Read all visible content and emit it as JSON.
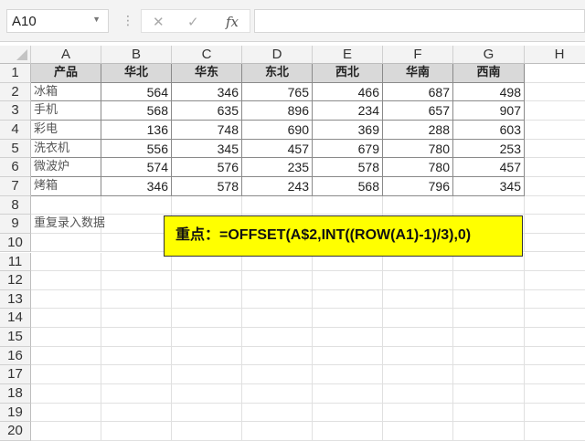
{
  "name_box": "A10",
  "formula_bar": "",
  "columns": [
    "A",
    "B",
    "C",
    "D",
    "E",
    "F",
    "G",
    "H"
  ],
  "rows": [
    "1",
    "2",
    "3",
    "4",
    "5",
    "6",
    "7",
    "8",
    "9",
    "10",
    "11",
    "12",
    "13",
    "14",
    "15",
    "16",
    "17",
    "18",
    "19",
    "20"
  ],
  "table": {
    "header": [
      "产品",
      "华北",
      "华东",
      "东北",
      "西北",
      "华南",
      "西南"
    ],
    "body": [
      [
        "冰箱",
        "564",
        "346",
        "765",
        "466",
        "687",
        "498"
      ],
      [
        "手机",
        "568",
        "635",
        "896",
        "234",
        "657",
        "907"
      ],
      [
        "彩电",
        "136",
        "748",
        "690",
        "369",
        "288",
        "603"
      ],
      [
        "洗衣机",
        "556",
        "345",
        "457",
        "679",
        "780",
        "253"
      ],
      [
        "微波炉",
        "574",
        "576",
        "235",
        "578",
        "780",
        "457"
      ],
      [
        "烤箱",
        "346",
        "578",
        "243",
        "568",
        "796",
        "345"
      ]
    ]
  },
  "a9": "重复录入数据",
  "note": "重点：=OFFSET(A$2,INT((ROW(A1)-1)/3),0)",
  "icons": {
    "cancel": "✕",
    "enter": "✓",
    "fx": "fx"
  }
}
